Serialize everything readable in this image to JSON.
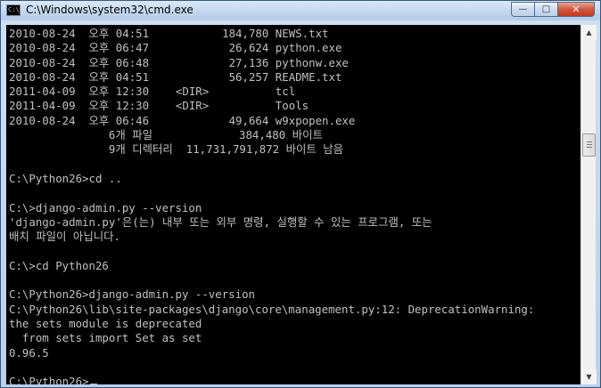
{
  "window": {
    "title": "C:\\Windows\\system32\\cmd.exe",
    "icon_label": "C:\\",
    "controls": {
      "minimize": "—",
      "maximize": "□",
      "close": "✕"
    }
  },
  "console": {
    "lines": [
      "2010-08-24  오후 04:51           184,780 NEWS.txt",
      "2010-08-24  오후 06:47            26,624 python.exe",
      "2010-08-24  오후 06:48            27,136 pythonw.exe",
      "2010-08-24  오후 04:51            56,257 README.txt",
      "2011-04-09  오후 12:30    <DIR>          tcl",
      "2011-04-09  오후 12:30    <DIR>          Tools",
      "2010-08-24  오후 06:46            49,664 w9xpopen.exe",
      "               6개 파일             384,480 바이트",
      "               9개 디렉터리  11,731,791,872 바이트 남음",
      "",
      "C:\\Python26>cd ..",
      "",
      "C:\\>django-admin.py --version",
      "'django-admin.py'은(는) 내부 또는 외부 명령, 실행할 수 있는 프로그램, 또는",
      "배치 파일이 아닙니다.",
      "",
      "C:\\>cd Python26",
      "",
      "C:\\Python26>django-admin.py --version",
      "C:\\Python26\\lib\\site-packages\\django\\core\\management.py:12: DeprecationWarning:",
      "the sets module is deprecated",
      "  from sets import Set as set",
      "0.96.5",
      "",
      "C:\\Python26>"
    ]
  },
  "scrollbar": {
    "up_arrow": "▲",
    "down_arrow": "▼"
  }
}
